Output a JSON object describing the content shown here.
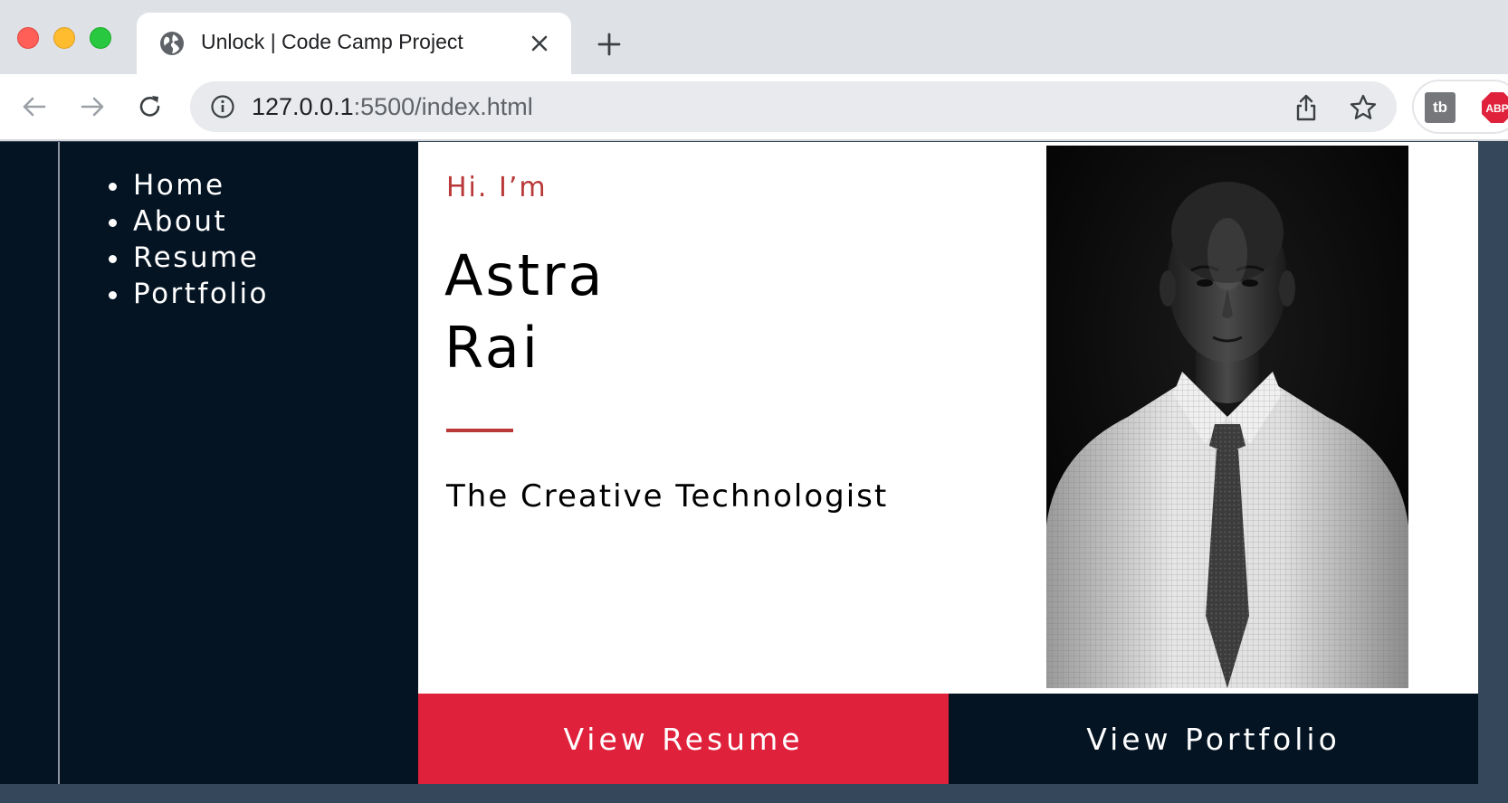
{
  "browser": {
    "tab_title": "Unlock | Code Camp Project",
    "url_host": "127.0.0.1",
    "url_path": ":5500/index.html",
    "extension_tb_label": "tb",
    "extension_abp_label": "ABP"
  },
  "nav": {
    "items": [
      {
        "label": "Home"
      },
      {
        "label": "About"
      },
      {
        "label": "Resume"
      },
      {
        "label": "Portfolio"
      }
    ]
  },
  "hero": {
    "greeting": "Hi. I’m",
    "first_name": "Astra",
    "last_name": "Rai",
    "tagline": "The Creative Technologist"
  },
  "buttons": {
    "resume": "View Resume",
    "portfolio": "View Portfolio"
  },
  "colors": {
    "accent_red": "#b93838",
    "button_red": "#e0213b",
    "navy": "#041423",
    "slate": "#35475a"
  }
}
